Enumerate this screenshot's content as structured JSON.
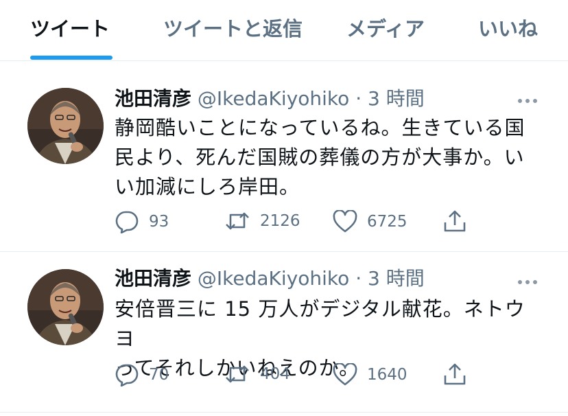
{
  "tabs": [
    "ツイート",
    "ツイートと返信",
    "メディア",
    "いいね"
  ],
  "tweets": [
    {
      "name": "池田清彦",
      "handle": "@IkedaKiyohiko",
      "dot": "·",
      "time": "3 時間",
      "text": "静岡酷いことになっているね。生きている国\n民より、死んだ国賊の葬儀の方が大事か。い\nい加減にしろ岸田。",
      "replies": "93",
      "retweets": "2126",
      "likes": "6725"
    },
    {
      "name": "池田清彦",
      "handle": "@IkedaKiyohiko",
      "dot": "·",
      "time": "3 時間",
      "text": "安倍晋三に 15 万人がデジタル献花。ネトウヨ\nってそれしかいねえのか。",
      "replies": "70",
      "retweets": "404",
      "likes": "1640"
    }
  ],
  "colors": {
    "accent": "#1d9bf0",
    "secondary_text": "#5b7083",
    "primary_text": "#0f1419",
    "divider": "#e6ecf0"
  },
  "icons": [
    "reply-icon",
    "retweet-icon",
    "like-icon",
    "share-icon",
    "more-icon"
  ]
}
